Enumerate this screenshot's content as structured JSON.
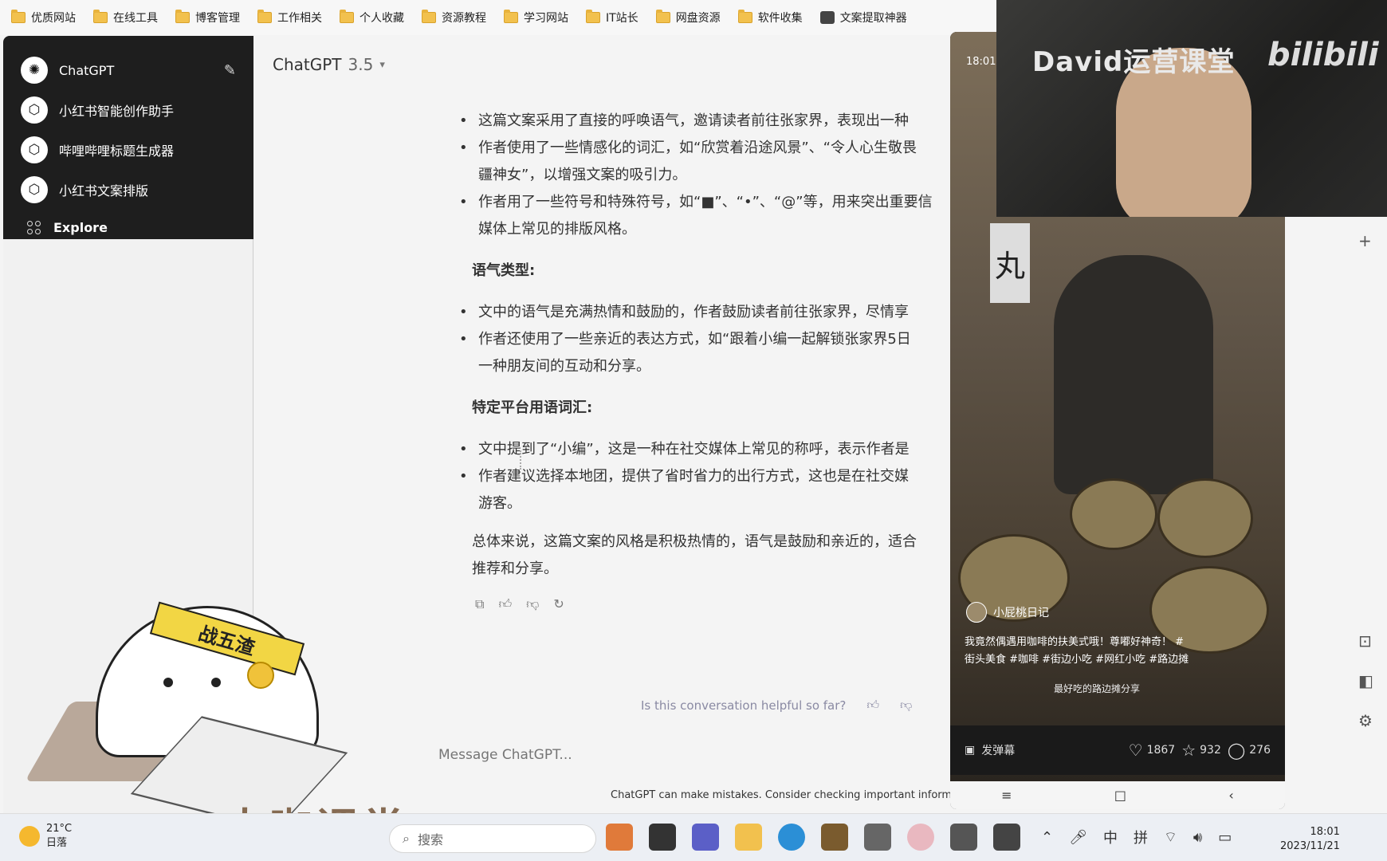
{
  "bookmarks": [
    {
      "label": "优质网站",
      "icon": "folder-icon"
    },
    {
      "label": "在线工具",
      "icon": "folder-icon"
    },
    {
      "label": "博客管理",
      "icon": "folder-icon"
    },
    {
      "label": "工作相关",
      "icon": "folder-icon"
    },
    {
      "label": "个人收藏",
      "icon": "folder-icon"
    },
    {
      "label": "资源教程",
      "icon": "folder-icon"
    },
    {
      "label": "学习网站",
      "icon": "folder-icon"
    },
    {
      "label": "IT站长",
      "icon": "folder-icon"
    },
    {
      "label": "网盘资源",
      "icon": "folder-icon"
    },
    {
      "label": "软件收集",
      "icon": "folder-icon"
    },
    {
      "label": "文案提取神器",
      "icon": "app-icon"
    }
  ],
  "sidebar": {
    "app_label": "ChatGPT",
    "gpts": [
      "小红书智能创作助手",
      "哔哩哔哩标题生成器",
      "小红书文案排版"
    ],
    "explore_label": "Explore"
  },
  "header": {
    "model_name": "ChatGPT",
    "model_version": "3.5",
    "chevron": "▾"
  },
  "response": {
    "bullets_1": [
      "这篇文案采用了直接的呼唤语气，邀请读者前往张家界，表现出一种",
      "作者使用了一些情感化的词汇，如“欣赏着沿途风景”、“令人心生敬畏",
      "疆神女”，以增强文案的吸引力。",
      "作者用了一些符号和特殊符号，如“■”、“•”、“@”等，用来突出重要信",
      "媒体上常见的排版风格。"
    ],
    "heading_tone": "语气类型",
    "bullets_2": [
      "文中的语气是充满热情和鼓励的，作者鼓励读者前往张家界，尽情享",
      "作者还使用了一些亲近的表达方式，如“跟着小编一起解锁张家界5日",
      "一种朋友间的互动和分享。"
    ],
    "heading_platform": "特定平台用语词汇",
    "bullets_3": [
      "文中提到了“小编”，这是一种在社交媒体上常见的称呼，表示作者是",
      "作者建议选择本地团，提供了省时省力的出行方式，这也是在社交媒",
      "游客。"
    ],
    "summary_1": "总体来说，这篇文案的风格是积极热情的，语气是鼓励和亲近的，适合",
    "summary_2": "推荐和分享。",
    "colon": ":"
  },
  "feedback": {
    "question": "Is this conversation helpful so far?"
  },
  "composer": {
    "placeholder": "Message ChatGPT..."
  },
  "disclaimer": "ChatGPT can make mistakes. Consider checking important inform",
  "webcam": {
    "title": "David运营课堂",
    "logo": "bilibili"
  },
  "phone": {
    "time": "18:01",
    "sign_char": "丸",
    "author": "小屁桃日记",
    "caption_1": "我竟然偶遇用咖啡的扶美式哦！尊嘟好神奇！ #",
    "caption_2": "街头美食 #咖啡 #街边小吃 #网红小吃 #路边摊",
    "music": "最好吃的路边摊分享",
    "danmu": "发弹幕",
    "likes": "1867",
    "favorites": "932",
    "comments": "276"
  },
  "sticker": {
    "band_text": "战五渣",
    "watermark": "大咖课堂"
  },
  "taskbar": {
    "temperature": "21°C",
    "weather": "日落",
    "search_placeholder": "搜索",
    "ime_1": "中",
    "ime_2": "拼",
    "time": "18:01",
    "date": "2023/11/21"
  }
}
